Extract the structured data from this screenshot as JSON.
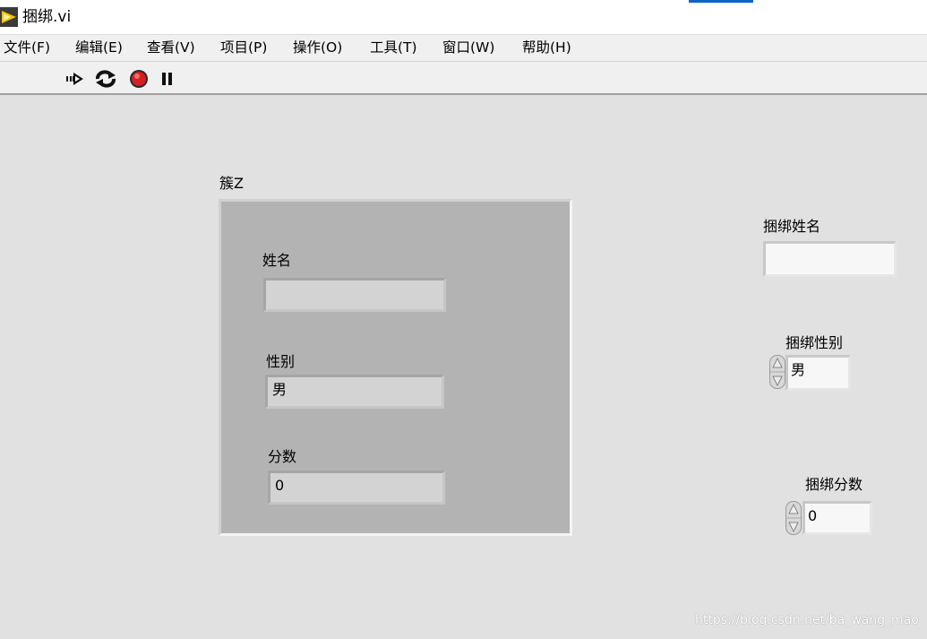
{
  "window": {
    "title": "捆绑.vi"
  },
  "menubar": {
    "items": [
      {
        "label": "文件(F)"
      },
      {
        "label": "编辑(E)"
      },
      {
        "label": "查看(V)"
      },
      {
        "label": "项目(P)"
      },
      {
        "label": "操作(O)"
      },
      {
        "label": "工具(T)"
      },
      {
        "label": "窗口(W)"
      },
      {
        "label": "帮助(H)"
      }
    ]
  },
  "toolbar": {
    "icons": [
      "run-arrow-icon",
      "run-continuously-icon",
      "abort-execution-icon",
      "pause-icon"
    ]
  },
  "cluster": {
    "label": "簇Z",
    "fields": {
      "name": {
        "label": "姓名",
        "value": ""
      },
      "gender": {
        "label": "性别",
        "value": "男"
      },
      "score": {
        "label": "分数",
        "value": "0"
      }
    }
  },
  "bundle": {
    "name": {
      "label": "捆绑姓名",
      "value": ""
    },
    "gender": {
      "label": "捆绑性别",
      "value": "男"
    },
    "score": {
      "label": "捆绑分数",
      "value": "0"
    }
  },
  "watermark": "https://blog.csdn.net/ba_wang_mao",
  "colors": {
    "panel_background": "#e1e1e1",
    "cluster_background": "#b3b3b3",
    "abort_button": "#d42020",
    "app_icon": "#f2c300"
  }
}
